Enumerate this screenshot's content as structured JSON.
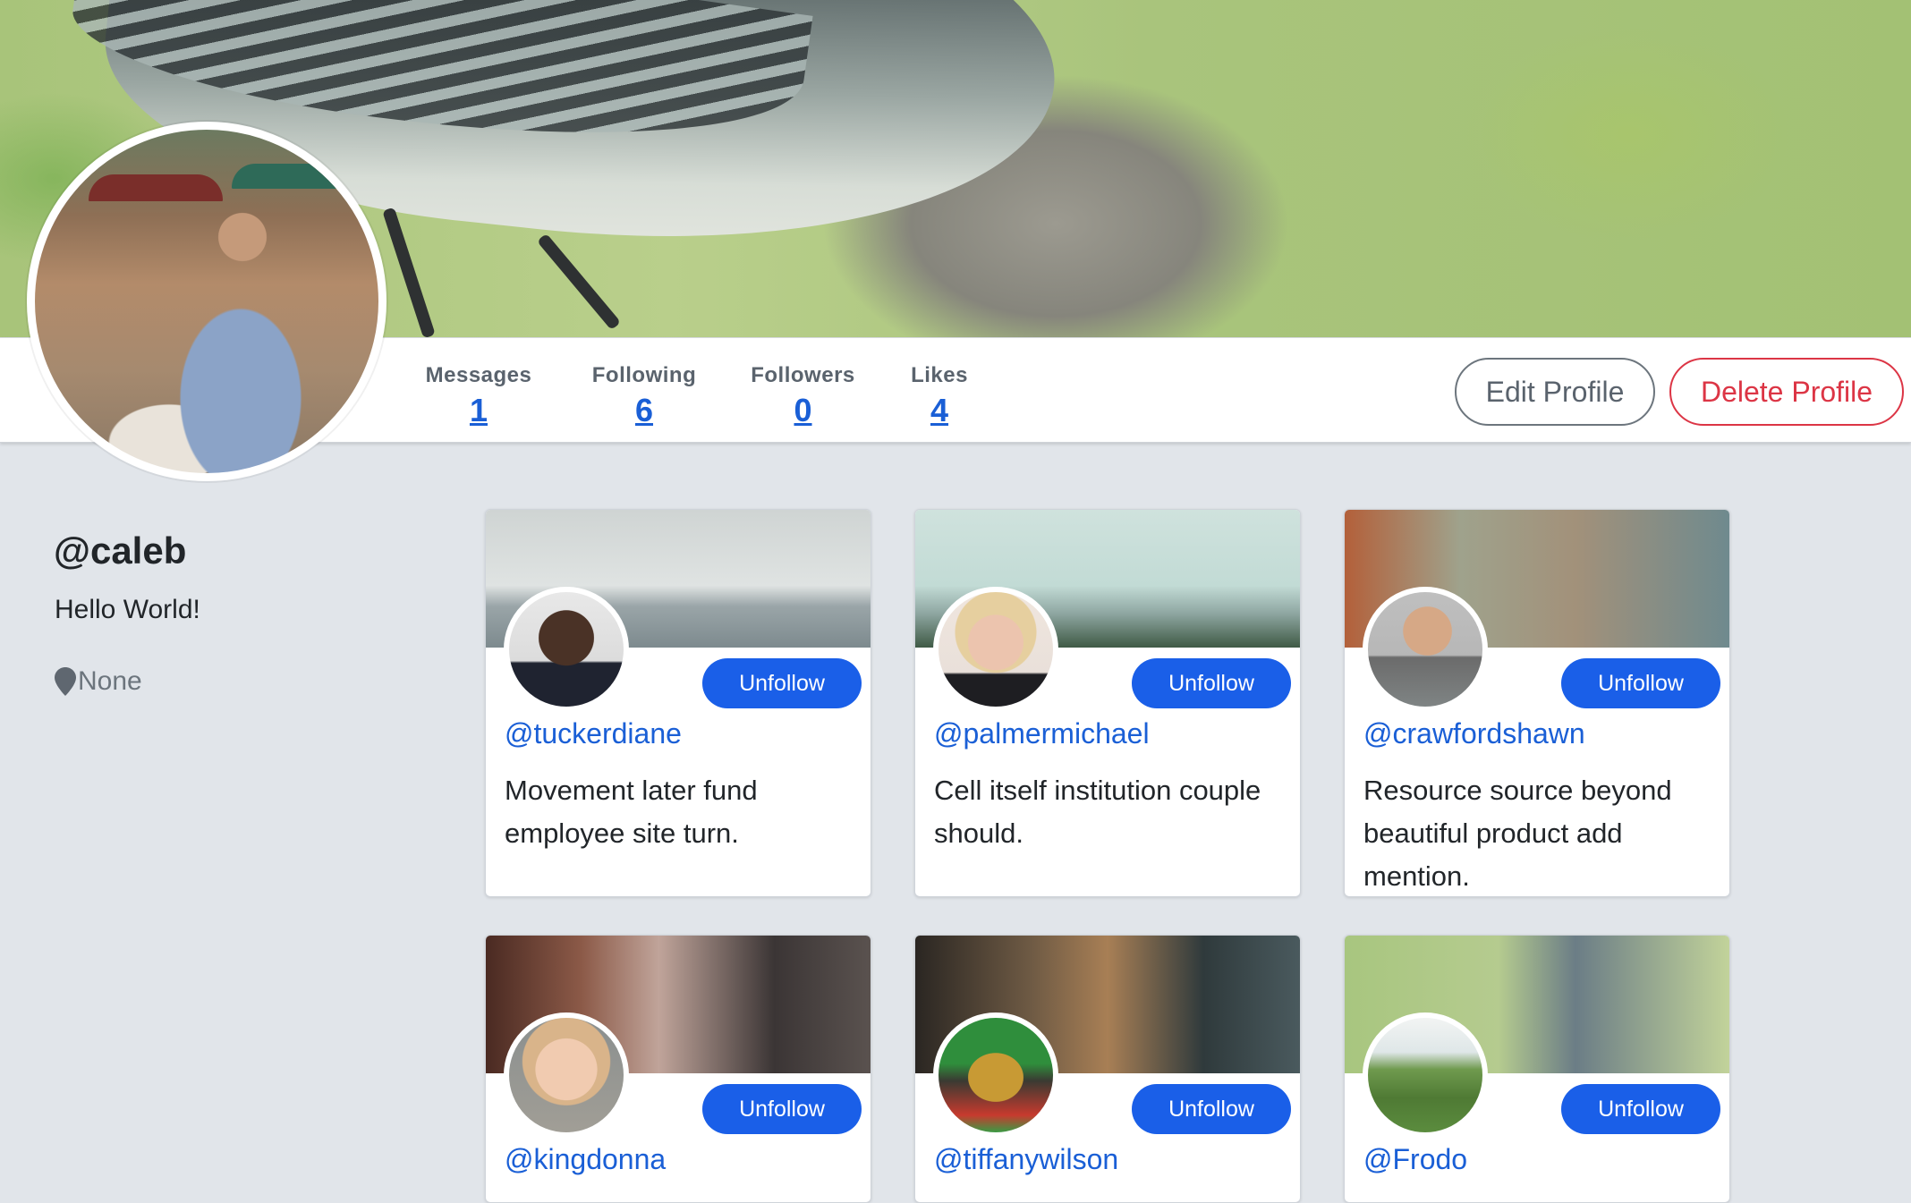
{
  "profile": {
    "handle": "@caleb",
    "bio": "Hello World!",
    "location": "None"
  },
  "stats": [
    {
      "label": "Messages",
      "value": "1"
    },
    {
      "label": "Following",
      "value": "6"
    },
    {
      "label": "Followers",
      "value": "0"
    },
    {
      "label": "Likes",
      "value": "4"
    }
  ],
  "actions": {
    "edit_label": "Edit Profile",
    "delete_label": "Delete Profile"
  },
  "colors": {
    "primary": "#1a5fe8",
    "danger": "#dc3545",
    "link": "#1a5fd6",
    "page_bg": "#e1e5ea"
  },
  "following": [
    {
      "username": "@tuckerdiane",
      "bio": "Movement later fund employee site turn.",
      "button": "Unfollow"
    },
    {
      "username": "@palmermichael",
      "bio": "Cell itself institution couple should.",
      "button": "Unfollow"
    },
    {
      "username": "@crawfordshawn",
      "bio": "Resource source beyond beautiful product add mention.",
      "button": "Unfollow"
    },
    {
      "username": "@kingdonna",
      "bio": "",
      "button": "Unfollow"
    },
    {
      "username": "@tiffanywilson",
      "bio": "",
      "button": "Unfollow"
    },
    {
      "username": "@Frodo",
      "bio": "",
      "button": "Unfollow"
    }
  ],
  "icons": {
    "location": "map-pin-icon"
  }
}
